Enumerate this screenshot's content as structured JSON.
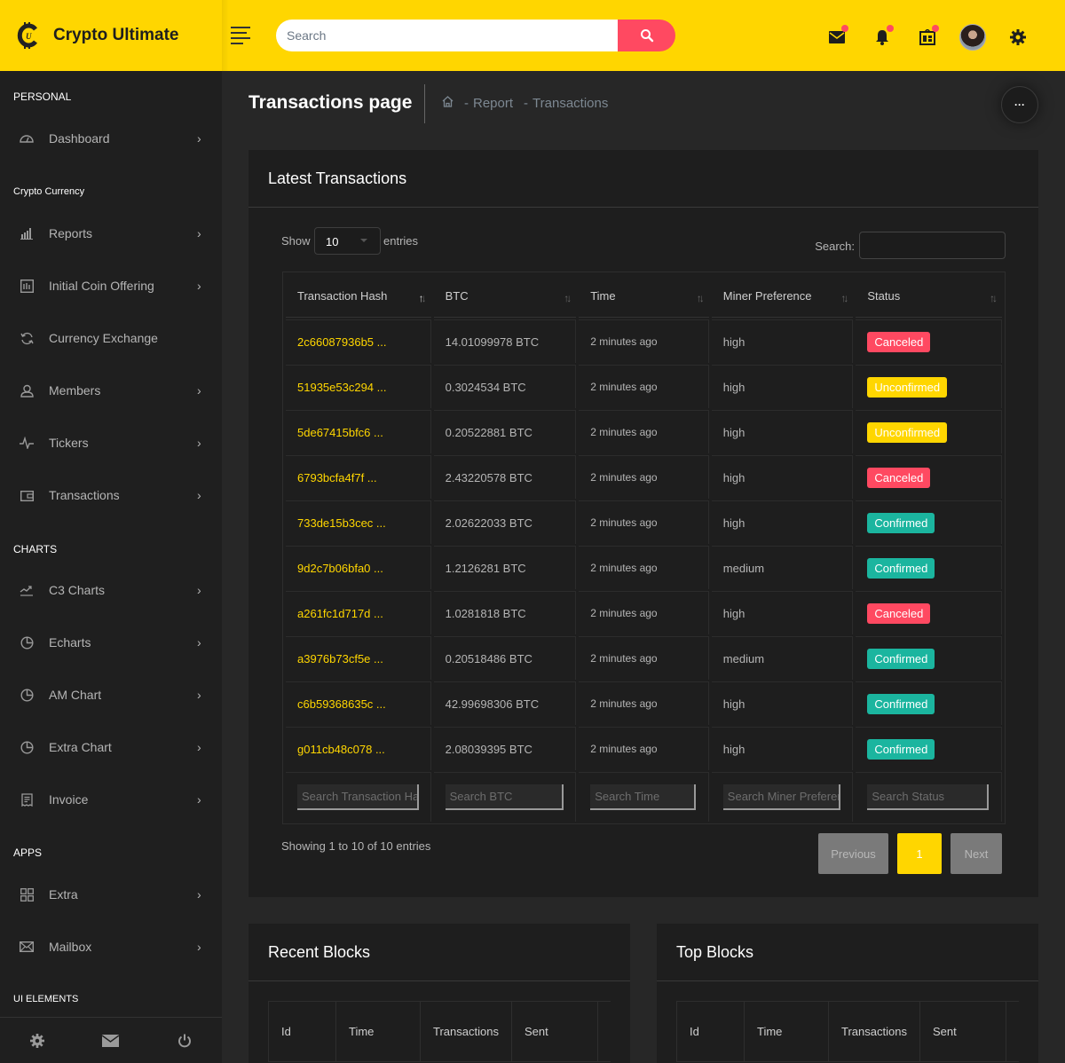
{
  "brand": {
    "name": "Crypto Ultimate",
    "logo_icon": "crypto-coin-logo"
  },
  "topbar": {
    "search_placeholder": "Search",
    "icons": [
      {
        "name": "mail-icon",
        "has_dot": true
      },
      {
        "name": "bell-icon",
        "has_dot": true
      },
      {
        "name": "calendar-widget-icon",
        "has_dot": true
      },
      {
        "name": "avatar",
        "has_dot": false
      },
      {
        "name": "gear-icon",
        "has_dot": false
      }
    ],
    "accent_color": "#ffd600",
    "alert_color": "#ff4961"
  },
  "sidebar": {
    "sections": [
      {
        "title": "PERSONAL",
        "items": [
          {
            "label": "Dashboard",
            "icon": "dashboard-gauge-icon",
            "chevron": true
          }
        ]
      },
      {
        "title": "Crypto Currency",
        "items": [
          {
            "label": "Reports",
            "icon": "bar-chart-icon",
            "chevron": true
          },
          {
            "label": "Initial Coin Offering",
            "icon": "ico-chart-icon",
            "chevron": true
          },
          {
            "label": "Currency Exchange",
            "icon": "refresh-icon",
            "chevron": false
          },
          {
            "label": "Members",
            "icon": "user-icon",
            "chevron": true
          },
          {
            "label": "Tickers",
            "icon": "pulse-icon",
            "chevron": true
          },
          {
            "label": "Transactions",
            "icon": "wallet-icon",
            "chevron": true
          }
        ]
      },
      {
        "title": "CHARTS",
        "items": [
          {
            "label": "C3 Charts",
            "icon": "trend-line-icon",
            "chevron": true
          },
          {
            "label": "Echarts",
            "icon": "pie-chart-icon",
            "chevron": true
          },
          {
            "label": "AM Chart",
            "icon": "pie-chart-icon",
            "chevron": true
          },
          {
            "label": "Extra Chart",
            "icon": "pie-chart-icon",
            "chevron": true
          },
          {
            "label": "Invoice",
            "icon": "receipt-icon",
            "chevron": true
          }
        ]
      },
      {
        "title": "APPS",
        "items": [
          {
            "label": "Extra",
            "icon": "grid-icon",
            "chevron": true
          },
          {
            "label": "Mailbox",
            "icon": "envelope-icon",
            "chevron": true
          }
        ]
      },
      {
        "title": "UI ELEMENTS",
        "items": []
      }
    ],
    "chevron": "›",
    "footer": [
      "gear-icon",
      "mail-icon",
      "power-icon"
    ]
  },
  "header": {
    "title": "Transactions page",
    "breadcrumb": [
      "Report",
      "Transactions"
    ],
    "more_label": "···"
  },
  "latest": {
    "title": "Latest Transactions",
    "show_label": "Show",
    "entries_label": "entries",
    "page_length": "10",
    "search_label": "Search:",
    "search_value": "",
    "columns": [
      "Transaction Hash",
      "BTC",
      "Time",
      "Miner Preference",
      "Status"
    ],
    "rows": [
      {
        "hash": "2c66087936b5 ...",
        "btc": "14.01099978 BTC",
        "time": "2 minutes ago",
        "miner": "high",
        "status": "Canceled"
      },
      {
        "hash": "51935e53c294 ...",
        "btc": "0.3024534 BTC",
        "time": "2 minutes ago",
        "miner": "high",
        "status": "Unconfirmed"
      },
      {
        "hash": "5de67415bfc6 ...",
        "btc": "0.20522881 BTC",
        "time": "2 minutes ago",
        "miner": "high",
        "status": "Unconfirmed"
      },
      {
        "hash": "6793bcfa4f7f ...",
        "btc": "2.43220578 BTC",
        "time": "2 minutes ago",
        "miner": "high",
        "status": "Canceled"
      },
      {
        "hash": "733de15b3cec ...",
        "btc": "2.02622033 BTC",
        "time": "2 minutes ago",
        "miner": "high",
        "status": "Confirmed"
      },
      {
        "hash": "9d2c7b06bfa0 ...",
        "btc": "1.2126281 BTC",
        "time": "2 minutes ago",
        "miner": "medium",
        "status": "Confirmed"
      },
      {
        "hash": "a261fc1d717d ...",
        "btc": "1.0281818 BTC",
        "time": "2 minutes ago",
        "miner": "high",
        "status": "Canceled"
      },
      {
        "hash": "a3976b73cf5e ...",
        "btc": "0.20518486 BTC",
        "time": "2 minutes ago",
        "miner": "medium",
        "status": "Confirmed"
      },
      {
        "hash": "c6b59368635c ...",
        "btc": "42.99698306 BTC",
        "time": "2 minutes ago",
        "miner": "high",
        "status": "Confirmed"
      },
      {
        "hash": "g011cb48c078 ...",
        "btc": "2.08039395 BTC",
        "time": "2 minutes ago",
        "miner": "high",
        "status": "Confirmed"
      }
    ],
    "status_colors": {
      "Canceled": "#ff4961",
      "Unconfirmed": "#ffd600",
      "Confirmed": "#1bb59f"
    },
    "filter_placeholders": [
      "Search Transaction Hash",
      "Search BTC",
      "Search Time",
      "Search Miner Preference",
      "Search Status"
    ],
    "info": "Showing 1 to 10 of 10 entries",
    "pager": {
      "previous": "Previous",
      "current": "1",
      "next": "Next"
    }
  },
  "recent_blocks": {
    "title": "Recent Blocks",
    "columns": [
      "Id",
      "Time",
      "Transactions",
      "Sent"
    ]
  },
  "top_blocks": {
    "title": "Top Blocks",
    "columns": [
      "Id",
      "Time",
      "Transactions",
      "Sent"
    ]
  }
}
